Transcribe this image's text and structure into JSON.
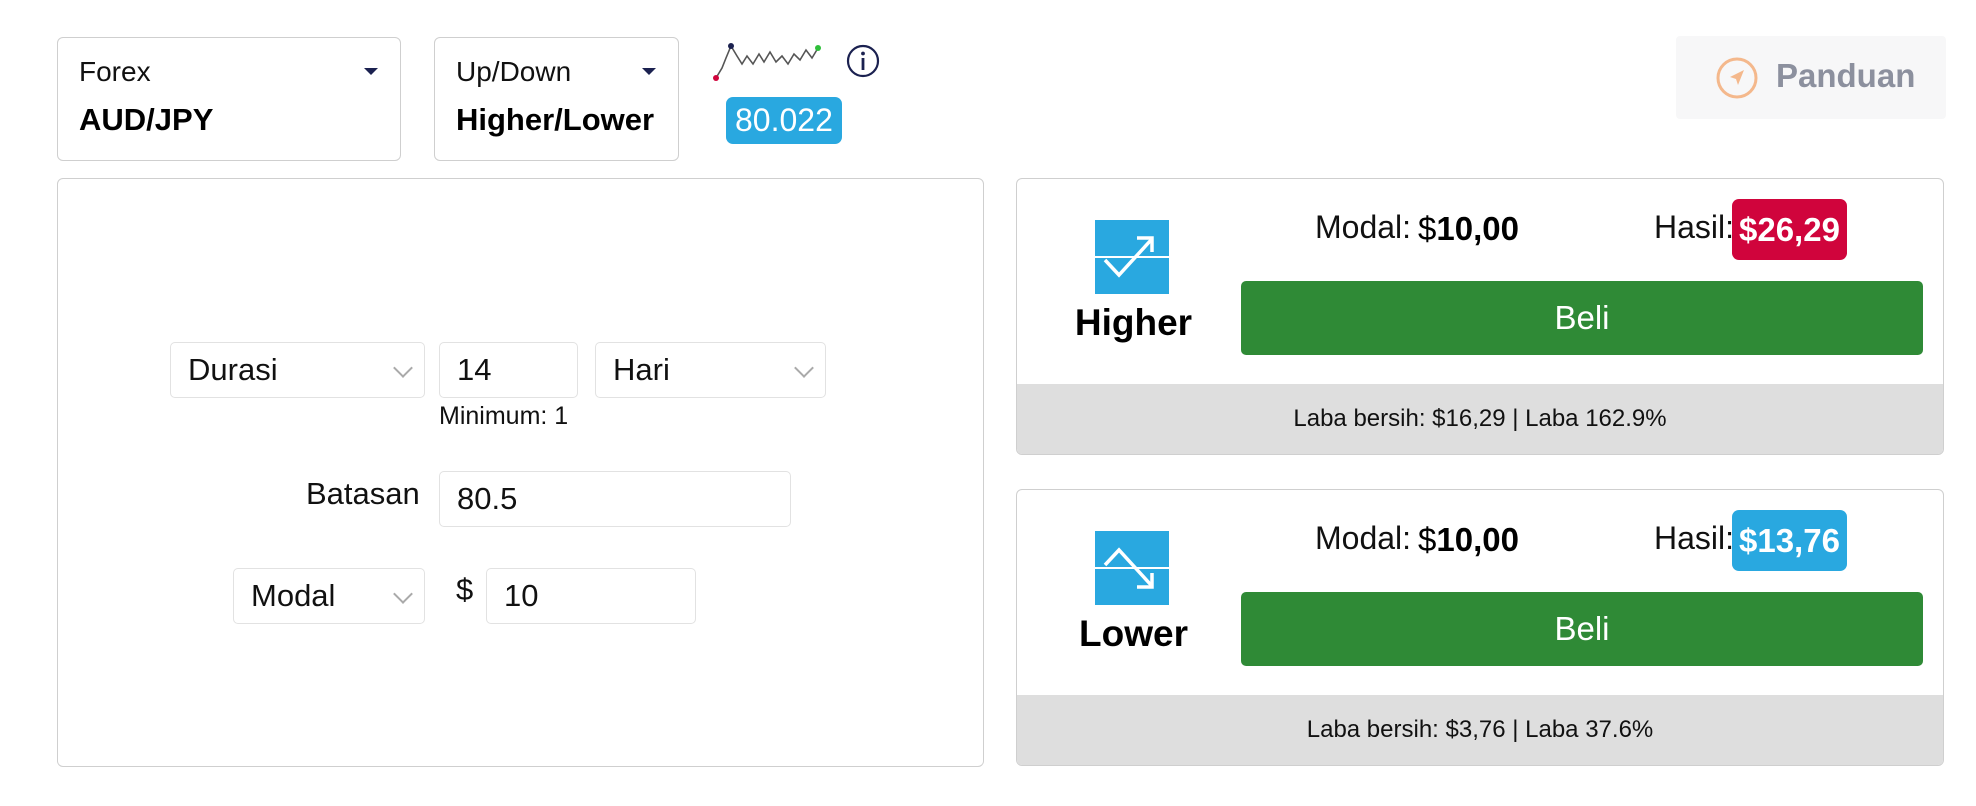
{
  "market_select": {
    "category": "Forex",
    "value": "AUD/JPY"
  },
  "type_select": {
    "category": "Up/Down",
    "value": "Higher/Lower"
  },
  "price": {
    "current": "80.022"
  },
  "guide": {
    "label": "Panduan",
    "icon": "navigation-arrow-icon"
  },
  "form": {
    "duration": {
      "mode": "Durasi",
      "value": "14",
      "unit": "Hari",
      "minimum_hint": "Minimum: 1"
    },
    "barrier": {
      "label": "Batasan",
      "value": "80.5"
    },
    "stake": {
      "mode": "Modal",
      "currency_symbol": "$",
      "value": "10"
    }
  },
  "contracts": [
    {
      "direction": "Higher",
      "icon": "trend-up-icon",
      "stake_label": "Modal:",
      "stake_currency": "$",
      "stake_amount": "10,00",
      "payout_label": "Hasil:",
      "payout": "$26,29",
      "payout_color": "#d0043c",
      "buy_label": "Beli",
      "profit_text": "Laba bersih: $16,29 | Laba 162.9%"
    },
    {
      "direction": "Lower",
      "icon": "trend-down-icon",
      "stake_label": "Modal:",
      "stake_currency": "$",
      "stake_amount": "10,00",
      "payout_label": "Hasil:",
      "payout": "$13,76",
      "payout_color": "#29a8e0",
      "buy_label": "Beli",
      "profit_text": "Laba bersih: $3,76 | Laba 37.6%"
    }
  ],
  "colors": {
    "accent": "#29a8e0",
    "buy": "#2f8a36",
    "navy": "#1b2150"
  }
}
